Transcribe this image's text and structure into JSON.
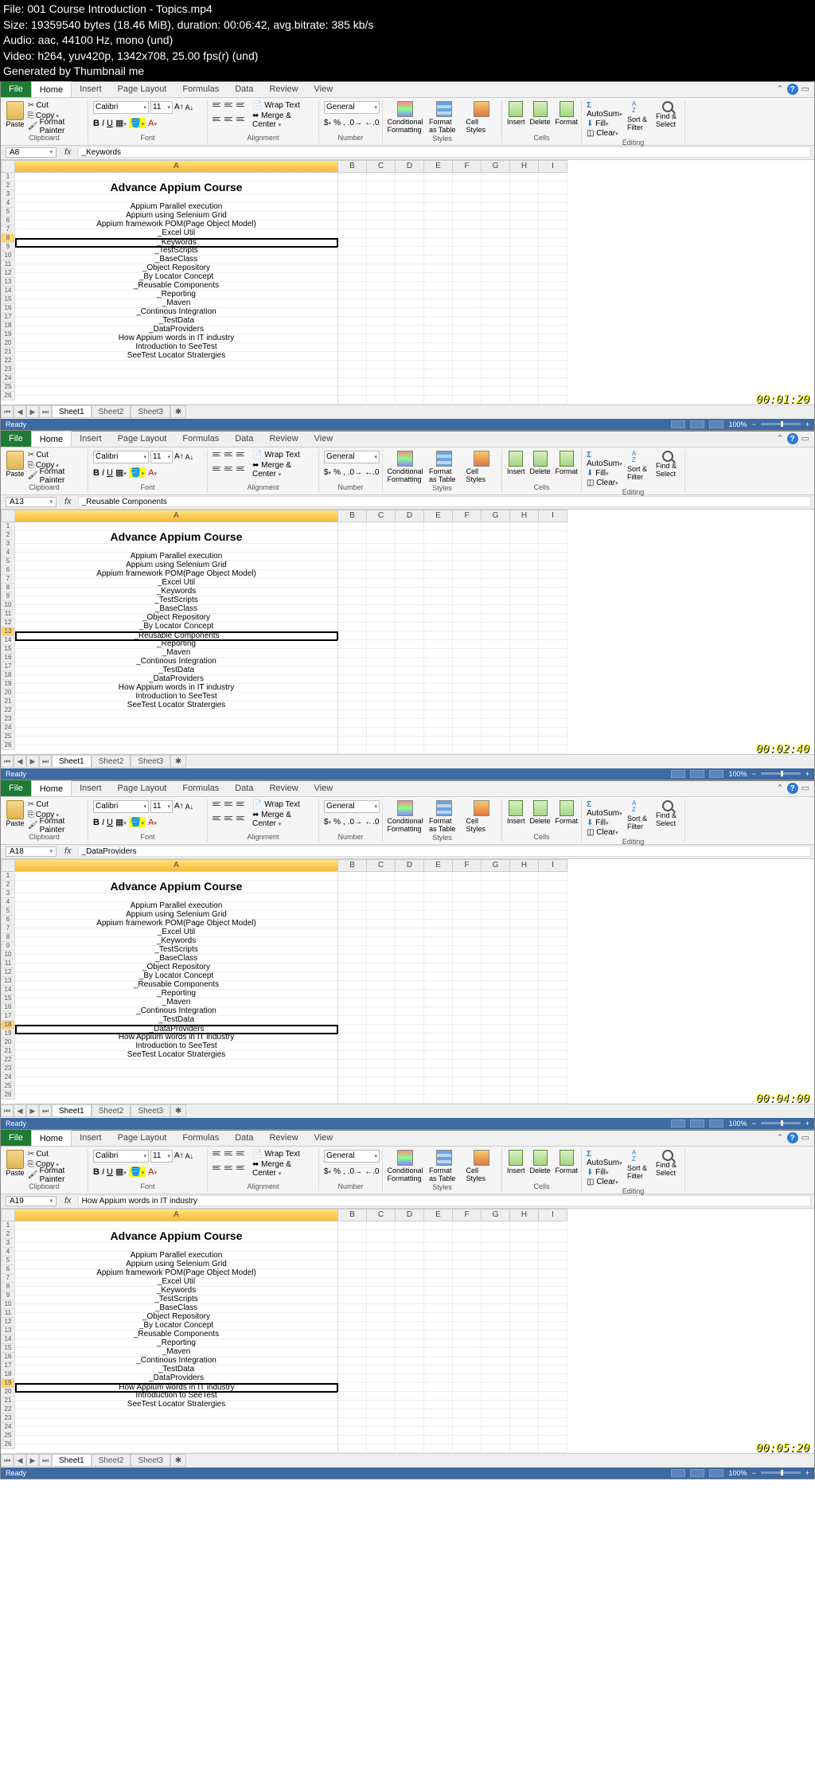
{
  "header": {
    "line1": "File: 001 Course Introduction - Topics.mp4",
    "line2": "Size: 19359540 bytes (18.46 MiB), duration: 00:06:42, avg.bitrate: 385 kb/s",
    "line3": "Audio: aac, 44100 Hz, mono (und)",
    "line4": "Video: h264, yuv420p, 1342x708, 25.00 fps(r) (und)",
    "line5": "Generated by Thumbnail me"
  },
  "ribbon": {
    "file": "File",
    "tabs": [
      "Home",
      "Insert",
      "Page Layout",
      "Formulas",
      "Data",
      "Review",
      "View"
    ],
    "active_tab": "Home",
    "cut": "Cut",
    "copy": "Copy",
    "format_painter": "Format Painter",
    "clipboard_label": "Clipboard",
    "font_name": "Calibri",
    "font_size": "11",
    "font_label": "Font",
    "wrap": "Wrap Text",
    "merge": "Merge & Center",
    "align_label": "Alignment",
    "general": "General",
    "number_label": "Number",
    "cond_fmt": "Conditional Formatting",
    "fmt_table": "Format as Table",
    "cell_styles": "Cell Styles",
    "styles_label": "Styles",
    "insert": "Insert",
    "delete": "Delete",
    "format": "Format",
    "cells_label": "Cells",
    "autosum": "AutoSum",
    "fill": "Fill",
    "clear": "Clear",
    "sort": "Sort & Filter",
    "find": "Find & Select",
    "editing_label": "Editing",
    "zoom": "100%",
    "status_ready": "Ready"
  },
  "sheets": [
    "Sheet1",
    "Sheet2",
    "Sheet3"
  ],
  "cols": [
    "A",
    "B",
    "C",
    "D",
    "E",
    "F",
    "G",
    "H",
    "I"
  ],
  "content": {
    "title": "Advance Appium Course",
    "items": [
      "Appium Parallel execution",
      "Appium using Selenium Grid",
      "Appium framework POM(Page Object Model)",
      "_Excel Util",
      "_Keywords",
      "_TestScripts",
      "_BaseClass",
      "_Object Repository",
      "_By Locator Concept",
      "_Reusable Components",
      "_Reporting",
      "_Maven",
      "_Continous Integration",
      "_TestData",
      "_DataProviders",
      "How Appium words in IT industry",
      "Introduction to SeeTest",
      "SeeTest Locator Stratergies"
    ]
  },
  "panels": [
    {
      "cell": "A8",
      "fx": "_Keywords",
      "sel_row_index": 5,
      "time": "00:01:20"
    },
    {
      "cell": "A13",
      "fx": "_Reusable Components",
      "sel_row_index": 10,
      "time": "00:02:40"
    },
    {
      "cell": "A18",
      "fx": "_DataProviders",
      "sel_row_index": 15,
      "time": "00:04:00"
    },
    {
      "cell": "A19",
      "fx": "How Appium words in IT industry",
      "sel_row_index": 16,
      "time": "00:05:20"
    }
  ]
}
